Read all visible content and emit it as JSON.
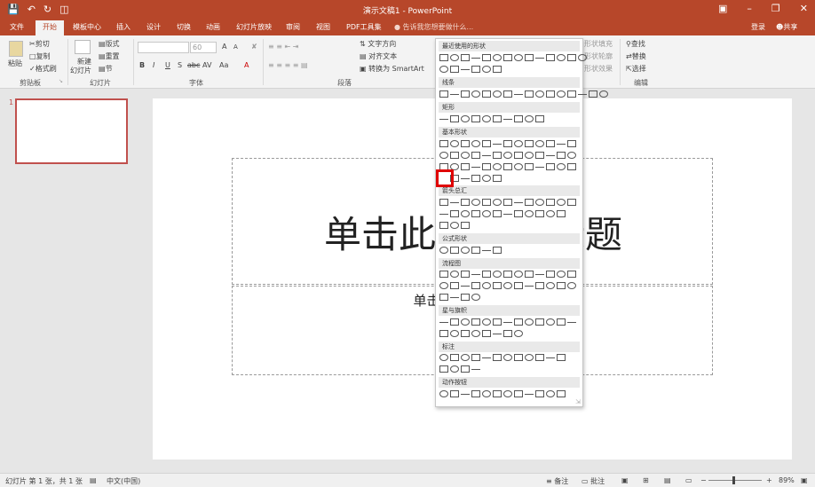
{
  "window": {
    "title": "演示文稿1 - PowerPoint",
    "qa_icons": [
      "save-icon",
      "undo-icon",
      "redo-icon",
      "presenter-icon"
    ],
    "winbtns": [
      "restore-ribbon-icon",
      "minimize-icon",
      "maximize-icon",
      "close-icon"
    ]
  },
  "tabs": [
    "文件",
    "开始",
    "模板中心",
    "插入",
    "设计",
    "切换",
    "动画",
    "幻灯片放映",
    "审阅",
    "视图",
    "PDF工具集"
  ],
  "active_tab": "开始",
  "tell_me": "告诉我您想要做什么...",
  "account": {
    "login": "登录",
    "share": "共享"
  },
  "ribbon": {
    "clipboard": {
      "paste": "粘贴",
      "cut": "剪切",
      "copy": "复制",
      "format_painter": "格式刷",
      "label": "剪贴板"
    },
    "slides": {
      "new_slide": "新建\n幻灯片",
      "new_slide_l1": "新建",
      "new_slide_l2": "幻灯片",
      "layout": "版式",
      "reset": "重置",
      "section": "节",
      "label": "幻灯片"
    },
    "font": {
      "font_name": "",
      "font_size": "60",
      "bold": "B",
      "italic": "I",
      "underline": "U",
      "shadow": "S",
      "strike": "abc",
      "spacing": "AV",
      "case": "Aa",
      "color": "A",
      "grow": "A",
      "shrink": "A",
      "label": "字体"
    },
    "paragraph": {
      "text_direction": "文字方向",
      "align_text": "对齐文本",
      "smartart": "转换为 SmartArt",
      "label": "段落"
    },
    "drawing": {
      "fill": "形状填充",
      "outline": "形状轮廓",
      "effects": "形状效果"
    },
    "editing": {
      "find": "查找",
      "replace": "替换",
      "select": "选择",
      "label": "编辑"
    }
  },
  "dropdown": {
    "sections": [
      "最近使用的形状",
      "线条",
      "矩形",
      "基本形状",
      "箭头总汇",
      "公式形状",
      "流程图",
      "星与旗帜",
      "标注",
      "动作按钮"
    ]
  },
  "slide_pane": {
    "slide_number": "1"
  },
  "slide": {
    "title_placeholder": "单击此处添加标题",
    "subtitle_placeholder": "单击此处添加副标题"
  },
  "status": {
    "slide_info": "幻灯片 第 1 张，共 1 张",
    "language": "中文(中国)",
    "notes": "备注",
    "comments": "批注",
    "zoom": "89%"
  },
  "colors": {
    "accent": "#b7472a",
    "selection": "#e00000"
  }
}
